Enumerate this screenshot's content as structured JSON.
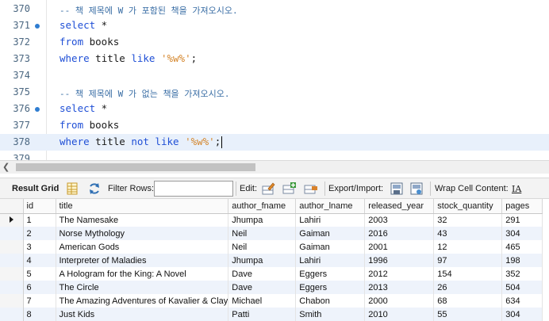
{
  "editor": {
    "lines": [
      {
        "num": "370",
        "dot": false,
        "current": false,
        "comment": "-- 책 제목에 W 가 포함된 책을 가져오시오."
      },
      {
        "num": "371",
        "dot": true,
        "current": false,
        "kw": "select",
        "text": " *"
      },
      {
        "num": "372",
        "dot": false,
        "current": false,
        "kw": "from",
        "text": " books"
      },
      {
        "num": "373",
        "dot": false,
        "current": false,
        "kw": "where",
        "text": " title ",
        "kw2": "like",
        "text2": " ",
        "str": "'%w%'",
        "text3": ";"
      },
      {
        "num": "374",
        "dot": false,
        "current": false
      },
      {
        "num": "375",
        "dot": false,
        "current": false,
        "comment": "-- 책 제목에 W 가 없는 책을 가져오시오."
      },
      {
        "num": "376",
        "dot": true,
        "current": false,
        "kw": "select",
        "text": " *"
      },
      {
        "num": "377",
        "dot": false,
        "current": false,
        "kw": "from",
        "text": " books"
      },
      {
        "num": "378",
        "dot": false,
        "current": true,
        "kw": "where",
        "text": " title ",
        "kw2": "not like",
        "text2": " ",
        "str": "'%w%'",
        "text3": ";"
      },
      {
        "num": "379",
        "dot": false,
        "current": false
      }
    ]
  },
  "toolbar": {
    "result_grid": "Result Grid",
    "filter_rows": "Filter Rows:",
    "filter_value": "",
    "edit": "Edit:",
    "export_import": "Export/Import:",
    "wrap_cell": "Wrap Cell Content:",
    "wrap_glyph": "IA"
  },
  "grid": {
    "columns": [
      "id",
      "title",
      "author_fname",
      "author_lname",
      "released_year",
      "stock_quantity",
      "pages"
    ],
    "rows": [
      [
        "1",
        "The Namesake",
        "Jhumpa",
        "Lahiri",
        "2003",
        "32",
        "291"
      ],
      [
        "2",
        "Norse Mythology",
        "Neil",
        "Gaiman",
        "2016",
        "43",
        "304"
      ],
      [
        "3",
        "American Gods",
        "Neil",
        "Gaiman",
        "2001",
        "12",
        "465"
      ],
      [
        "4",
        "Interpreter of Maladies",
        "Jhumpa",
        "Lahiri",
        "1996",
        "97",
        "198"
      ],
      [
        "5",
        "A Hologram for the King: A Novel",
        "Dave",
        "Eggers",
        "2012",
        "154",
        "352"
      ],
      [
        "6",
        "The Circle",
        "Dave",
        "Eggers",
        "2013",
        "26",
        "504"
      ],
      [
        "7",
        "The Amazing Adventures of Kavalier & Clay",
        "Michael",
        "Chabon",
        "2000",
        "68",
        "634"
      ],
      [
        "8",
        "Just Kids",
        "Patti",
        "Smith",
        "2010",
        "55",
        "304"
      ]
    ],
    "selected_row": 0
  },
  "colors": {
    "keyword": "#1f4fd6",
    "string": "#d4852a",
    "comment": "#3a6ea5",
    "line_number": "#4a6680",
    "breakpoint_dot": "#2f7dd1",
    "row_alt": "#eef3fb"
  }
}
